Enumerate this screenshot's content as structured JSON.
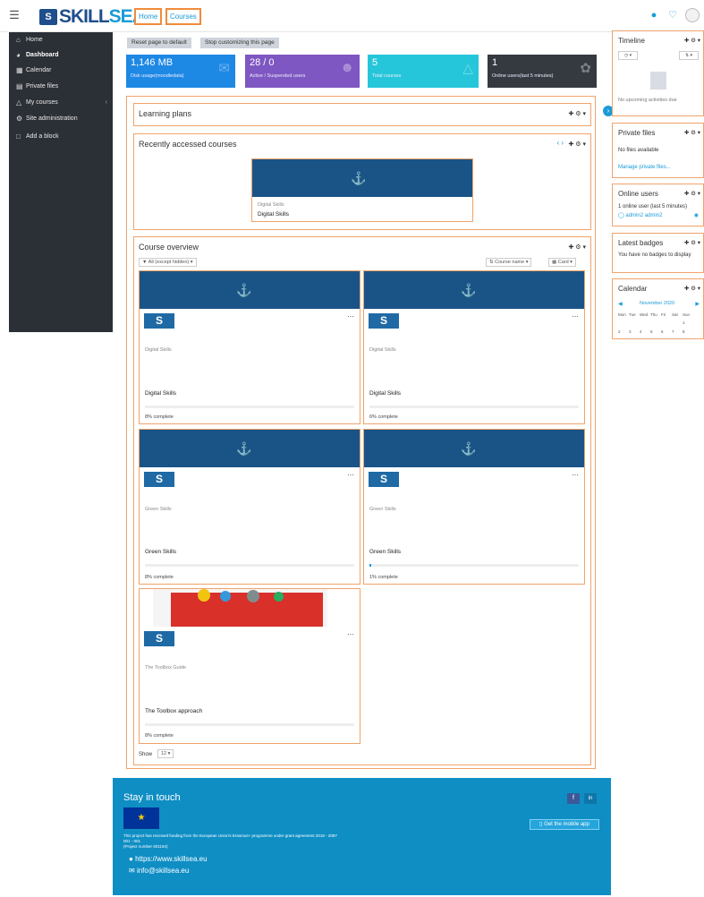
{
  "nav": {
    "home": "Home",
    "courses": "Courses"
  },
  "logo": {
    "part1": "SKILL",
    "part2": "SEA"
  },
  "sidebar": {
    "items": [
      {
        "label": "Home",
        "icon": "home-icon"
      },
      {
        "label": "Dashboard",
        "icon": "dashboard-icon"
      },
      {
        "label": "Calendar",
        "icon": "calendar-icon"
      },
      {
        "label": "Private files",
        "icon": "file-icon"
      },
      {
        "label": "My courses",
        "icon": "graduation-cap-icon"
      },
      {
        "label": "Site administration",
        "icon": "gear-icon"
      },
      {
        "label": "Add a block",
        "icon": "folder-icon"
      }
    ]
  },
  "buttons": {
    "reset": "Reset page to default",
    "stop": "Stop customizing this page"
  },
  "tiles": [
    {
      "value": "1,146 MB",
      "label": "Disk usage(moodledata)",
      "color": "#1e88e5"
    },
    {
      "value": "28 / 0",
      "label": "Active / Suspended users",
      "color": "#7e57c2"
    },
    {
      "value": "5",
      "label": "Total courses",
      "color": "#26c6da"
    },
    {
      "value": "1",
      "label": "Online users(last 5 minutes)",
      "color": "#343a40"
    }
  ],
  "blocks": {
    "learning_plans": "Learning plans",
    "recent": "Recently accessed courses",
    "recent_card": {
      "category": "Digital Skills",
      "name": "Digital Skills"
    },
    "overview": "Course overview",
    "filter": "All (except hidden)",
    "sort": "Course name",
    "view": "Card",
    "show_label": "Show",
    "show_value": "12"
  },
  "courses": [
    {
      "category": "Digital Skills",
      "name": "Digital Skills",
      "progress": "8% complete"
    },
    {
      "category": "Digital Skills",
      "name": "Digital Skills",
      "progress": "6% complete"
    },
    {
      "category": "Green Skills",
      "name": "Green Skills",
      "progress": "8% complete"
    },
    {
      "category": "Green Skills",
      "name": "Green Skills",
      "progress": "1% complete"
    },
    {
      "category": "The Toolbox Guide",
      "name": "The Toolbox approach",
      "progress": "8% complete"
    }
  ],
  "right": {
    "timeline": {
      "title": "Timeline",
      "empty": "No upcoming activities due"
    },
    "private_files": {
      "title": "Private files",
      "empty": "No files available",
      "link": "Manage private files..."
    },
    "online_users": {
      "title": "Online users",
      "text": "1 online user (last 5 minutes)",
      "user": "admin2 admin2"
    },
    "badges": {
      "title": "Latest badges",
      "text": "You have no badges to display"
    },
    "calendar": {
      "title": "Calendar",
      "month": "November 2020",
      "days": [
        "Mon",
        "Tue",
        "Wed",
        "Thu",
        "Fri",
        "Sat",
        "Sun"
      ],
      "row1": [
        "",
        "",
        "",
        "",
        "",
        "",
        "1"
      ],
      "row2": [
        "2",
        "3",
        "4",
        "5",
        "6",
        "7",
        "8"
      ]
    }
  },
  "footer": {
    "title": "Stay in touch",
    "funding": "This project has received funding from the European Union's Erasmus+ programme under grant agreement 2018 - 2087",
    "line2": "001 - 001",
    "project": "(Project number 601184)",
    "web": "https://www.skillsea.eu",
    "email": "info@skillsea.eu",
    "app": "Get the mobile app"
  },
  "colors": {
    "accent": "#1a9bd7",
    "highlight": "#f08b3b",
    "sidebar": "#2b2f36",
    "footer": "#0f8ec4"
  }
}
